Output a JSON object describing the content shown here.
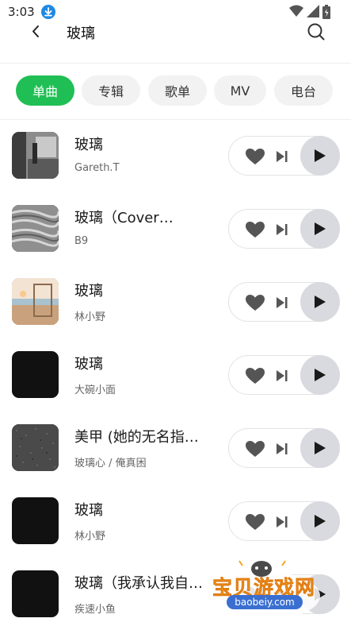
{
  "status_bar": {
    "time": "3:03"
  },
  "header": {
    "title": "玻璃"
  },
  "tabs": [
    {
      "label": "单曲",
      "active": true
    },
    {
      "label": "专辑",
      "active": false
    },
    {
      "label": "歌单",
      "active": false
    },
    {
      "label": "MV",
      "active": false
    },
    {
      "label": "电台",
      "active": false
    }
  ],
  "songs": [
    {
      "title": "玻璃",
      "artist": "Gareth.T"
    },
    {
      "title": "玻璃（Cover…",
      "artist": "B9"
    },
    {
      "title": "玻璃",
      "artist": "林小野"
    },
    {
      "title": "玻璃",
      "artist": "大碗小面"
    },
    {
      "title": "美甲 (她的无名指…",
      "artist": "玻璃心 / 俺真困"
    },
    {
      "title": "玻璃",
      "artist": "林小野"
    },
    {
      "title": "玻璃（我承认我自…",
      "artist": "疾速小鱼"
    }
  ],
  "watermark": {
    "text": "宝贝游戏网",
    "url": "baobeiy.com"
  },
  "colors": {
    "accent": "#20bf55",
    "play_bg": "#d9dadf",
    "icon_gray": "#555555"
  },
  "icons": {
    "back": "chevron-left-icon",
    "search": "search-icon",
    "like": "heart-icon",
    "next": "skip-next-icon",
    "play": "play-icon"
  }
}
